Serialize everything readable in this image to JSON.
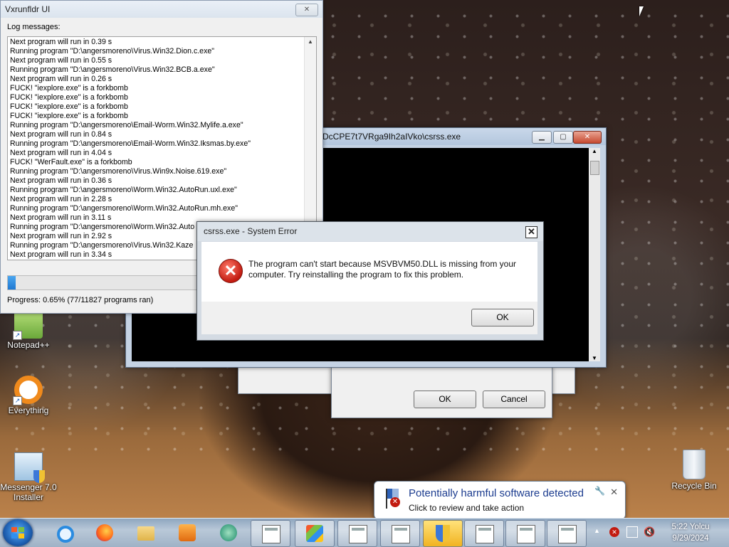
{
  "vx_window": {
    "title": "Vxrunfldr UI",
    "log_label": "Log messages:",
    "log": [
      "Next program will run in 0.39 s",
      "Running program \"D:\\angersmoreno\\Virus.Win32.Dion.c.exe\"",
      "Next program will run in 0.55 s",
      "Running program \"D:\\angersmoreno\\Virus.Win32.BCB.a.exe\"",
      "Next program will run in 0.26 s",
      "FUCK! \"iexplore.exe\" is a forkbomb",
      "FUCK! \"iexplore.exe\" is a forkbomb",
      "FUCK! \"iexplore.exe\" is a forkbomb",
      "FUCK! \"iexplore.exe\" is a forkbomb",
      "Running program \"D:\\angersmoreno\\Email-Worm.Win32.Mylife.a.exe\"",
      "Next program will run in 0.84 s",
      "Running program \"D:\\angersmoreno\\Email-Worm.Win32.Iksmas.by.exe\"",
      "Next program will run in 4.04 s",
      "FUCK! \"WerFault.exe\" is a forkbomb",
      "Running program \"D:\\angersmoreno\\Virus.Win9x.Noise.619.exe\"",
      "Next program will run in 0.36 s",
      "Running program \"D:\\angersmoreno\\Worm.Win32.AutoRun.uxl.exe\"",
      "Next program will run in 2.28 s",
      "Running program \"D:\\angersmoreno\\Worm.Win32.AutoRun.mh.exe\"",
      "Next program will run in 3.11 s",
      "Running program \"D:\\angersmoreno\\Worm.Win32.Auto",
      "Next program will run in 2.92 s",
      "Running program \"D:\\angersmoreno\\Virus.Win32.Kaze",
      "Next program will run in 3.34 s"
    ],
    "progress_fraction": 0.0065,
    "progress_text": "Progress: 0.65% (77/11827 programs ran)"
  },
  "console_window": {
    "title": "DcCPE7t7VRga9Ih2aIVko\\csrss.exe"
  },
  "back_dialog": {
    "ok_label": "OK",
    "cancel_label": "Cancel"
  },
  "error_dialog": {
    "title": "csrss.exe - System Error",
    "message": "The program can't start because MSVBVM50.DLL is missing from your computer. Try reinstalling the program to fix this problem.",
    "ok_label": "OK",
    "close_glyph": "✕"
  },
  "desktop_icons": [
    {
      "label": "Notepad++"
    },
    {
      "label": "Everything"
    },
    {
      "label": "Messenger 7.0 Installer"
    },
    {
      "label": "Recycle Bin"
    }
  ],
  "notification": {
    "title": "Potentially harmful software detected",
    "subtitle": "Click to review and take action"
  },
  "taskbar": {
    "time": "5:22 Yolcu",
    "date": "9/29/2024"
  },
  "colors": {
    "accent_blue": "#1c3c8f",
    "error_red": "#c21b10",
    "progress_fill": "#1f78d1"
  }
}
